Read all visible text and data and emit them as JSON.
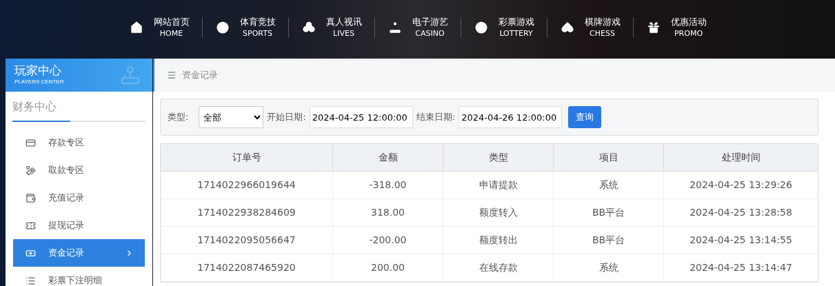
{
  "nav": [
    {
      "label": "网站首页",
      "sublabel": "HOME"
    },
    {
      "label": "体育竞技",
      "sublabel": "SPORTS"
    },
    {
      "label": "真人视讯",
      "sublabel": "LIVES"
    },
    {
      "label": "电子游艺",
      "sublabel": "CASINO"
    },
    {
      "label": "彩票游戏",
      "sublabel": "LOTTERY"
    },
    {
      "label": "棋牌游戏",
      "sublabel": "CHESS"
    },
    {
      "label": "优惠活动",
      "sublabel": "PROMO"
    }
  ],
  "sidebar": {
    "title": "玩家中心",
    "subtitle": "PLAYERS CENTER",
    "section": "财务中心",
    "items": [
      {
        "label": "存款专区",
        "selected": false
      },
      {
        "label": "取款专区",
        "selected": false
      },
      {
        "label": "充值记录",
        "selected": false
      },
      {
        "label": "提现记录",
        "selected": false
      },
      {
        "label": "资金记录",
        "selected": true
      },
      {
        "label": "彩票下注明细",
        "selected": false
      }
    ]
  },
  "breadcrumb": "资金记录",
  "filter": {
    "type_label": "类型:",
    "type_value": "全部",
    "start_label": "开始日期:",
    "start_value": "2024-04-25 12:00:00",
    "end_label": "结束日期:",
    "end_value": "2024-04-26 12:00:00",
    "button": "查询"
  },
  "table": {
    "columns": [
      "订单号",
      "金额",
      "类型",
      "项目",
      "处理时间"
    ],
    "rows": [
      [
        "1714022966019644",
        "-318.00",
        "申请提款",
        "系统",
        "2024-04-25 13:29:26"
      ],
      [
        "1714022938284609",
        "318.00",
        "额度转入",
        "BB平台",
        "2024-04-25 13:28:58"
      ],
      [
        "1714022095056647",
        "-200.00",
        "额度转出",
        "BB平台",
        "2024-04-25 13:14:55"
      ],
      [
        "1714022087465920",
        "200.00",
        "在线存款",
        "系统",
        "2024-04-25 13:14:47"
      ]
    ]
  }
}
